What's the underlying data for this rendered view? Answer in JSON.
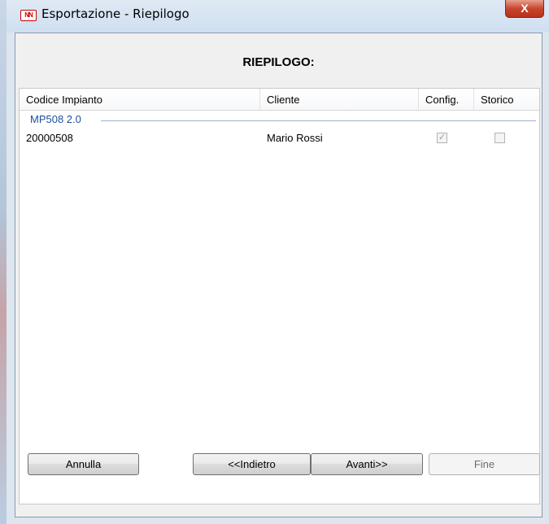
{
  "window": {
    "title": "Esportazione - Riepilogo",
    "icon_text": "NN",
    "close_symbol": "X"
  },
  "page": {
    "title": "RIEPILOGO:"
  },
  "list": {
    "columns": [
      "Codice Impianto",
      "Cliente",
      "Config.",
      "Storico"
    ],
    "groups": [
      {
        "name": "MP508 2.0",
        "rows": [
          {
            "codice": "20000508",
            "cliente": "Mario Rossi",
            "config_checked": true,
            "config_mark": "✓",
            "storico_checked": false
          }
        ]
      }
    ]
  },
  "buttons": {
    "annulla": "Annulla",
    "indietro": "<<Indietro",
    "avanti": "Avanti>>",
    "fine": "Fine"
  },
  "colors": {
    "group_text": "#1e4fa0",
    "close_button": "#c7452e"
  }
}
